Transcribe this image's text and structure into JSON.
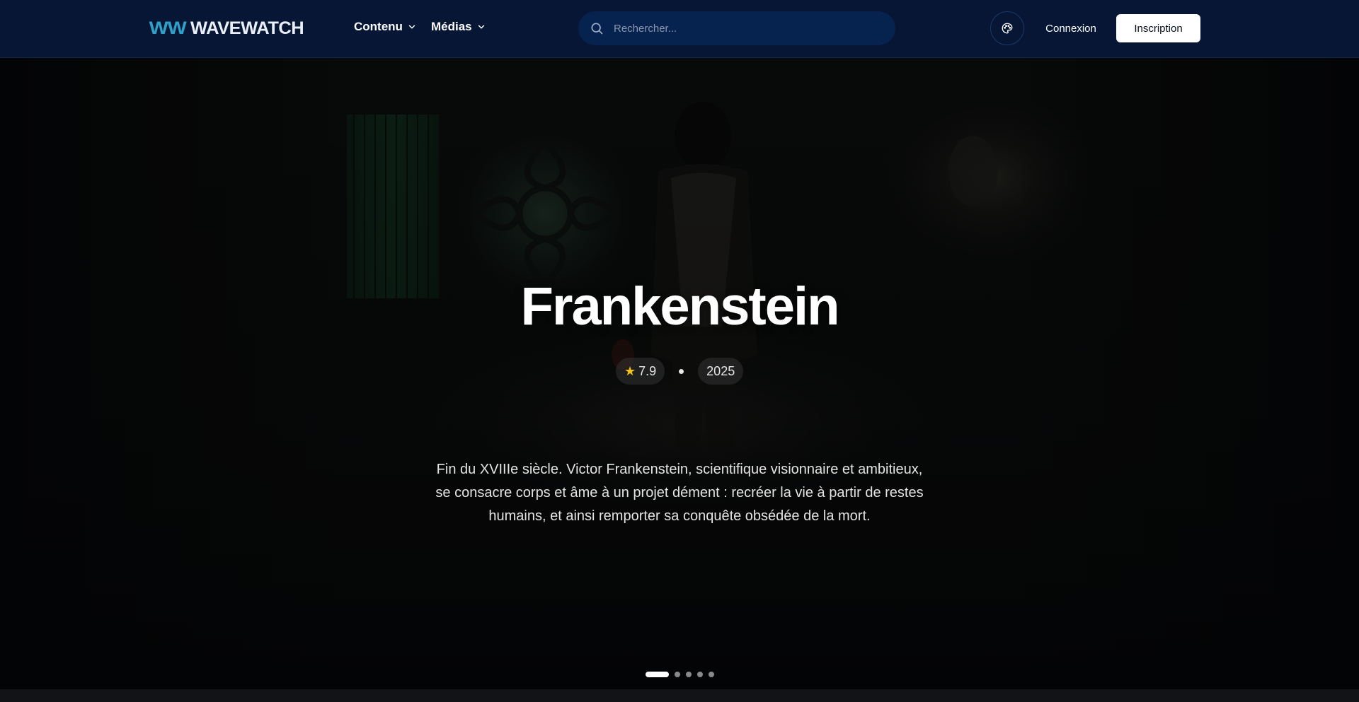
{
  "brand": {
    "mark": "WW",
    "name": "WAVEWATCH"
  },
  "nav": {
    "items": [
      {
        "label": "Contenu"
      },
      {
        "label": "Médias"
      }
    ]
  },
  "search": {
    "placeholder": "Rechercher..."
  },
  "actions": {
    "login": "Connexion",
    "signup": "Inscription"
  },
  "hero": {
    "title": "Frankenstein",
    "rating": "7.9",
    "year": "2025",
    "description": "Fin du XVIIIe siècle. Victor Frankenstein, scientifique visionnaire et ambitieux, se consacre corps et âme à un projet dément : recréer la vie à partir de restes humains, et ainsi remporter sa conquête obsédée de la mort.",
    "slides_total": 5,
    "active_slide": 1
  },
  "colors": {
    "navbar_bg": "#061634",
    "search_bg": "#06224e",
    "accent_logo": "#2fa0c8",
    "star": "#f3c317"
  }
}
